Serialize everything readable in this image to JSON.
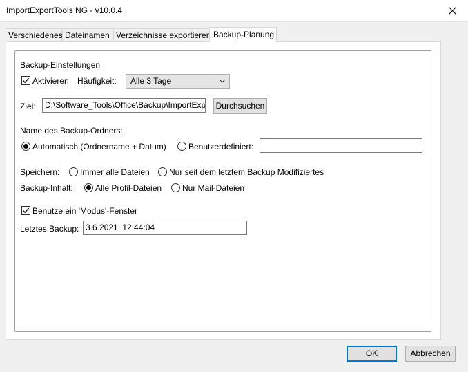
{
  "window": {
    "title": "ImportExportTools NG - v10.0.4"
  },
  "tabs": [
    "Verschiedenes",
    "Dateinamen",
    "Verzeichnisse exportieren",
    "Backup-Planung"
  ],
  "backup": {
    "group_title": "Backup-Einstellungen",
    "activate_label": "Aktivieren",
    "activate_checked": true,
    "frequency_label": "Häufigkeit:",
    "frequency_value": "Alle 3 Tage",
    "target_label": "Ziel:",
    "target_value": "D:\\Software_Tools\\Office\\Backup\\ImportExp",
    "browse_label": "Durchsuchen",
    "folder_name_heading": "Name des Backup-Ordners:",
    "folder_auto_label": "Automatisch (Ordnername + Datum)",
    "folder_custom_label": "Benutzerdefiniert:",
    "folder_custom_value": "",
    "save_label": "Speichern:",
    "save_all_label": "Immer alle Dateien",
    "save_modified_label": "Nur seit dem letztem Backup Modifiziertes",
    "content_label": "Backup-Inhalt:",
    "content_all_label": "Alle Profil-Dateien",
    "content_mail_label": "Nur Mail-Dateien",
    "modal_label": "Benutze ein 'Modus'-Fenster",
    "modal_checked": true,
    "last_backup_label": "Letztes Backup:",
    "last_backup_value": "3.6.2021, 12:44:04"
  },
  "footer": {
    "ok_label": "OK",
    "cancel_label": "Abbrechen"
  }
}
